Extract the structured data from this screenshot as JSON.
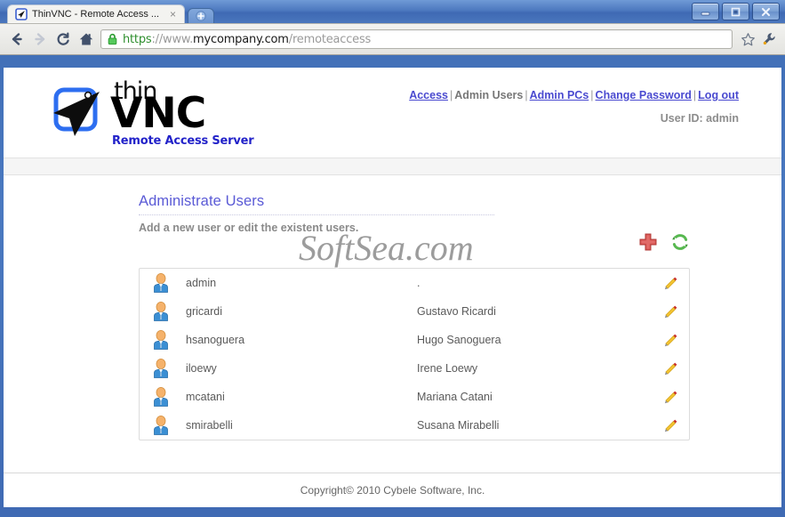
{
  "browser": {
    "tab": {
      "title": "ThinVNC - Remote Access ...",
      "close_label": "×",
      "favicon_name": "thinvnc-favicon"
    },
    "new_tab_label": "+",
    "nav": {
      "back_label": "Back",
      "forward_label": "Forward",
      "reload_label": "Reload",
      "home_label": "Home"
    },
    "url": {
      "scheme": "https",
      "separator": "://www.",
      "host": "mycompany.com",
      "path": "/remoteaccess",
      "full": "https://www.mycompany.com/remoteaccess"
    },
    "bookmark_label": "Bookmark this page",
    "tools_label": "Customize and control",
    "window_controls": {
      "minimize": "Minimize",
      "maximize": "Maximize",
      "close": "Close"
    }
  },
  "site": {
    "logo": {
      "thin": "thin",
      "vnc": "VNC",
      "tagline": "Remote Access Server"
    },
    "nav_links": [
      {
        "label": "Access",
        "current": false
      },
      {
        "label": "Admin Users",
        "current": true
      },
      {
        "label": "Admin PCs",
        "current": false
      },
      {
        "label": "Change Password",
        "current": false
      },
      {
        "label": "Log out",
        "current": false
      }
    ],
    "separator": "|",
    "user_id": "User ID: admin"
  },
  "main": {
    "title": "Administrate Users",
    "subtitle": "Add a new user or edit the existent users.",
    "watermark": "SoftSea.com",
    "actions": [
      {
        "name": "add-user-button",
        "label": "Add user",
        "icon": "plus-icon",
        "color": "#d9534f"
      },
      {
        "name": "refresh-button",
        "label": "Refresh",
        "icon": "refresh-icon",
        "color": "#5cb85c"
      }
    ],
    "users": [
      {
        "username": "admin",
        "fullname": "."
      },
      {
        "username": "gricardi",
        "fullname": "Gustavo Ricardi"
      },
      {
        "username": "hsanoguera",
        "fullname": "Hugo Sanoguera"
      },
      {
        "username": "iloewy",
        "fullname": "Irene Loewy"
      },
      {
        "username": "mcatani",
        "fullname": "Mariana Catani"
      },
      {
        "username": "smirabelli",
        "fullname": "Susana Mirabelli"
      }
    ],
    "edit_label": "Edit"
  },
  "footer": {
    "copyright": "Copyright© 2010 Cybele Software, Inc."
  },
  "colors": {
    "link": "#4a4ad0",
    "title": "#5a5ad6",
    "muted": "#8a8a8a",
    "add": "#d9534f",
    "refresh": "#5cb85c",
    "pencil": "#f2c230",
    "chrome_blue": "#4a79c0"
  }
}
